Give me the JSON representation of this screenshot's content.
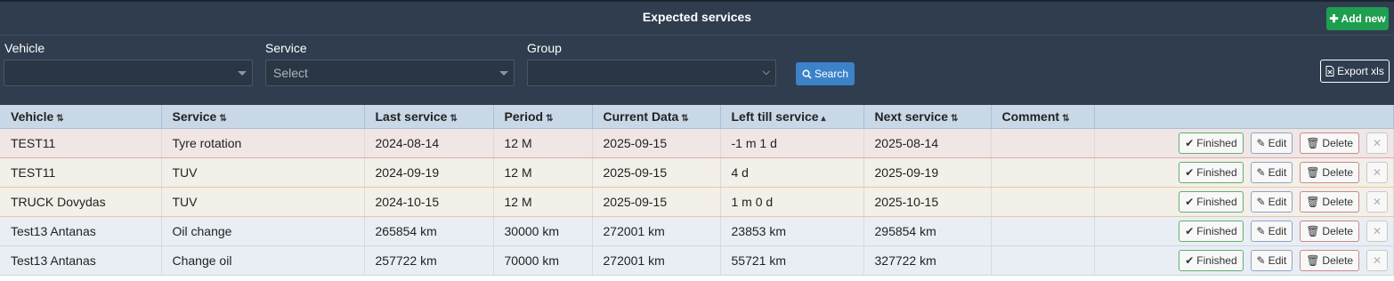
{
  "header": {
    "title": "Expected services",
    "add_label": "Add new",
    "export_label": "Export xls",
    "search_label": "Search"
  },
  "filters": {
    "vehicle": {
      "label": "Vehicle",
      "value": ""
    },
    "service": {
      "label": "Service",
      "value": "Select"
    },
    "group": {
      "label": "Group",
      "value": ""
    }
  },
  "table": {
    "columns": [
      "Vehicle",
      "Service",
      "Last service",
      "Period",
      "Current Data",
      "Left till service",
      "Next service",
      "Comment"
    ],
    "sorted_column": "Left till service",
    "rows": [
      {
        "vehicle": "TEST11",
        "service": "Tyre rotation",
        "last": "2024-08-14",
        "period": "12 M",
        "current": "2025-09-15",
        "left": "-1 m 1 d",
        "next": "2025-08-14",
        "comment": ""
      },
      {
        "vehicle": "TEST11",
        "service": "TUV",
        "last": "2024-09-19",
        "period": "12 M",
        "current": "2025-09-15",
        "left": "4 d",
        "next": "2025-09-19",
        "comment": ""
      },
      {
        "vehicle": "TRUCK Dovydas",
        "service": "TUV",
        "last": "2024-10-15",
        "period": "12 M",
        "current": "2025-09-15",
        "left": "1 m 0 d",
        "next": "2025-10-15",
        "comment": ""
      },
      {
        "vehicle": "Test13 Antanas",
        "service": "Oil change",
        "last": "265854 km",
        "period": "30000 km",
        "current": "272001 km",
        "left": "23853 km",
        "next": "295854 km",
        "comment": ""
      },
      {
        "vehicle": "Test13 Antanas",
        "service": "Change oil",
        "last": "257722 km",
        "period": "70000 km",
        "current": "272001 km",
        "left": "55721 km",
        "next": "327722 km",
        "comment": ""
      }
    ]
  },
  "row_actions": {
    "finished_label": "Finished",
    "edit_label": "Edit",
    "delete_label": "Delete"
  },
  "colors": {
    "panel_bg": "#2f3d4e",
    "add_button": "#1e9e4f",
    "search_button": "#3b82c9",
    "header_row": "#c9d8e6"
  }
}
